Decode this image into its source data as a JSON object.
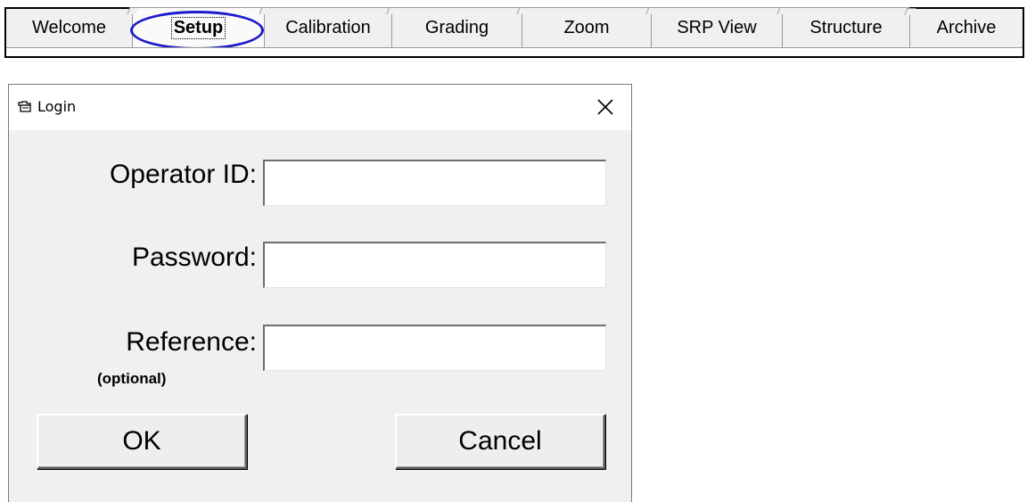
{
  "tabs": [
    {
      "label": "Welcome"
    },
    {
      "label": "Setup",
      "active": true
    },
    {
      "label": "Calibration"
    },
    {
      "label": "Grading"
    },
    {
      "label": "Zoom"
    },
    {
      "label": "SRP View"
    },
    {
      "label": "Structure"
    },
    {
      "label": "Archive"
    }
  ],
  "highlight_color": "#1a1acc",
  "dialog": {
    "title": "Login",
    "icon": "window-app-icon",
    "close_icon": "close-x-icon",
    "fields": {
      "operator_id": {
        "label": "Operator ID:",
        "value": ""
      },
      "password": {
        "label": "Password:",
        "value": ""
      },
      "reference": {
        "label": "Reference:",
        "sublabel": "(optional)",
        "value": ""
      }
    },
    "buttons": {
      "ok": "OK",
      "cancel": "Cancel"
    }
  }
}
